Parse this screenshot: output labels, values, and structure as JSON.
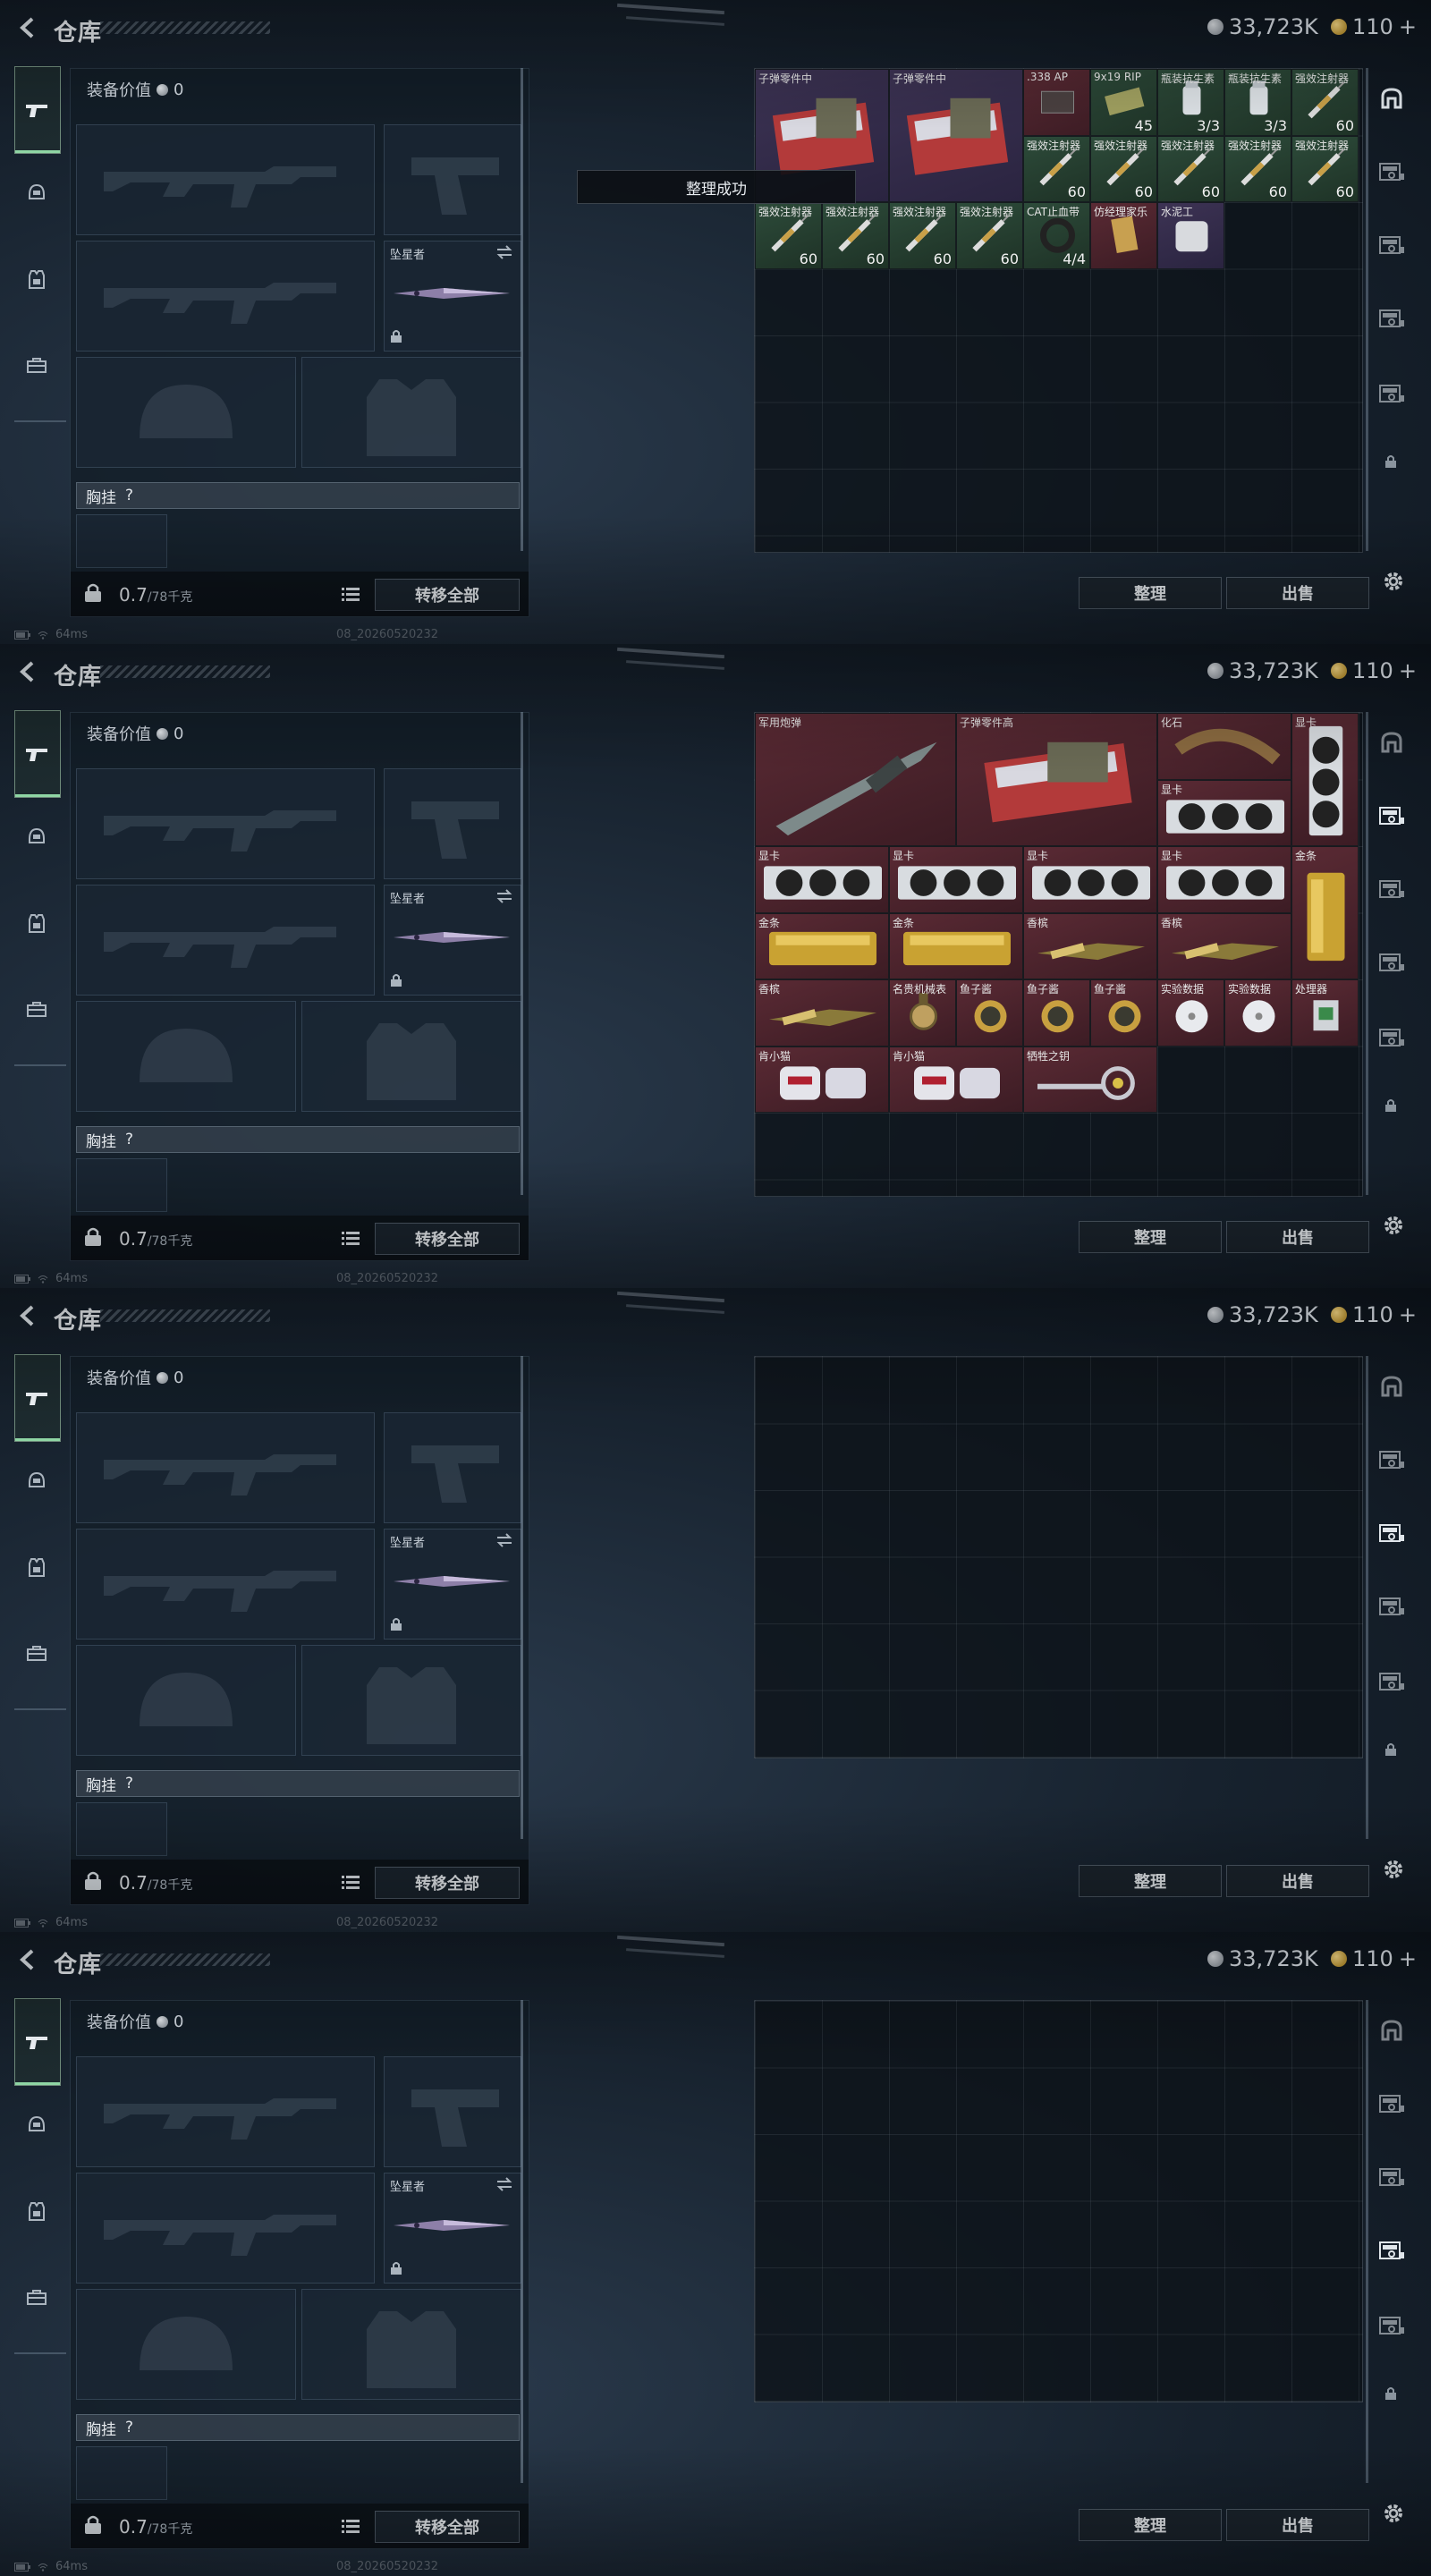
{
  "header": {
    "title": "仓库",
    "silver_amount": "33,723K",
    "gold_amount": "110",
    "gold_plus": "+"
  },
  "equipment": {
    "value_label": "装备价值",
    "value": "0",
    "knife_slot_label": "坠星者",
    "chest_label": "胸挂",
    "chest_help": "?",
    "weight_current": "0.7",
    "weight_max": "/78千克",
    "transfer_all": "转移全部"
  },
  "storage": {
    "organize_label": "整理",
    "sell_label": "出售",
    "toast": "整理成功"
  },
  "status": {
    "ping": "64ms",
    "uid": "08_20260520232"
  },
  "frames": [
    {
      "active_tab": 0,
      "show_toast": true,
      "items": [
        {
          "name": "子弹零件中",
          "col": 0,
          "row": 0,
          "w": 2,
          "h": 2,
          "bg": "purple",
          "vis": "ammo-parts"
        },
        {
          "name": "子弹零件中",
          "col": 2,
          "row": 0,
          "w": 2,
          "h": 2,
          "bg": "purple",
          "vis": "ammo-parts"
        },
        {
          "name": ".338 AP",
          "col": 4,
          "row": 0,
          "w": 1,
          "h": 1,
          "bg": "red",
          "vis": "ammo"
        },
        {
          "name": "9x19 RIP",
          "col": 5,
          "row": 0,
          "w": 1,
          "h": 1,
          "bg": "green",
          "vis": "ammo-box",
          "count": "45"
        },
        {
          "name": "瓶装抗生素",
          "col": 6,
          "row": 0,
          "w": 1,
          "h": 1,
          "bg": "green",
          "vis": "bottle",
          "count": "3/3"
        },
        {
          "name": "瓶装抗生素",
          "col": 7,
          "row": 0,
          "w": 1,
          "h": 1,
          "bg": "green",
          "vis": "bottle",
          "count": "3/3"
        },
        {
          "name": "强效注射器",
          "col": 8,
          "row": 0,
          "w": 1,
          "h": 1,
          "bg": "green",
          "vis": "syringe",
          "count": "60"
        },
        {
          "name": "强效注射器",
          "col": 4,
          "row": 1,
          "w": 1,
          "h": 1,
          "bg": "green",
          "vis": "syringe",
          "count": "60"
        },
        {
          "name": "强效注射器",
          "col": 5,
          "row": 1,
          "w": 1,
          "h": 1,
          "bg": "green",
          "vis": "syringe",
          "count": "60"
        },
        {
          "name": "强效注射器",
          "col": 6,
          "row": 1,
          "w": 1,
          "h": 1,
          "bg": "green",
          "vis": "syringe",
          "count": "60"
        },
        {
          "name": "强效注射器",
          "col": 7,
          "row": 1,
          "w": 1,
          "h": 1,
          "bg": "green",
          "vis": "syringe",
          "count": "60"
        },
        {
          "name": "强效注射器",
          "col": 8,
          "row": 1,
          "w": 1,
          "h": 1,
          "bg": "green",
          "vis": "syringe",
          "count": "60"
        },
        {
          "name": "强效注射器",
          "col": 0,
          "row": 2,
          "w": 1,
          "h": 1,
          "bg": "green",
          "vis": "syringe",
          "count": "60"
        },
        {
          "name": "强效注射器",
          "col": 1,
          "row": 2,
          "w": 1,
          "h": 1,
          "bg": "green",
          "vis": "syringe",
          "count": "60"
        },
        {
          "name": "强效注射器",
          "col": 2,
          "row": 2,
          "w": 1,
          "h": 1,
          "bg": "green",
          "vis": "syringe",
          "count": "60"
        },
        {
          "name": "强效注射器",
          "col": 3,
          "row": 2,
          "w": 1,
          "h": 1,
          "bg": "green",
          "vis": "syringe",
          "count": "60"
        },
        {
          "name": "CAT止血带",
          "col": 4,
          "row": 2,
          "w": 1,
          "h": 1,
          "bg": "green",
          "vis": "tourniquet",
          "count": "4/4"
        },
        {
          "name": "仿经理家乐",
          "col": 5,
          "row": 2,
          "w": 1,
          "h": 1,
          "bg": "red",
          "vis": "box"
        },
        {
          "name": "水泥工",
          "col": 6,
          "row": 2,
          "w": 1,
          "h": 1,
          "bg": "purple",
          "vis": "bag"
        }
      ]
    },
    {
      "active_tab": 1,
      "show_toast": false,
      "items": [
        {
          "name": "军用炮弹",
          "col": 0,
          "row": 0,
          "w": 3,
          "h": 2,
          "bg": "red",
          "vis": "shell"
        },
        {
          "name": "子弹零件高",
          "col": 3,
          "row": 0,
          "w": 3,
          "h": 2,
          "bg": "red",
          "vis": "ammo-parts"
        },
        {
          "name": "化石",
          "col": 6,
          "row": 0,
          "w": 2,
          "h": 1,
          "bg": "red",
          "vis": "fossil"
        },
        {
          "name": "显卡",
          "col": 8,
          "row": 0,
          "w": 1,
          "h": 2,
          "bg": "red",
          "vis": "gpu-v"
        },
        {
          "name": "显卡",
          "col": 6,
          "row": 1,
          "w": 2,
          "h": 1,
          "bg": "red",
          "vis": "gpu"
        },
        {
          "name": "显卡",
          "col": 0,
          "row": 2,
          "w": 2,
          "h": 1,
          "bg": "red",
          "vis": "gpu"
        },
        {
          "name": "显卡",
          "col": 2,
          "row": 2,
          "w": 2,
          "h": 1,
          "bg": "red",
          "vis": "gpu"
        },
        {
          "name": "显卡",
          "col": 4,
          "row": 2,
          "w": 2,
          "h": 1,
          "bg": "red",
          "vis": "gpu"
        },
        {
          "name": "显卡",
          "col": 6,
          "row": 2,
          "w": 2,
          "h": 1,
          "bg": "red",
          "vis": "gpu"
        },
        {
          "name": "金条",
          "col": 8,
          "row": 2,
          "w": 1,
          "h": 2,
          "bg": "red",
          "vis": "gold-v"
        },
        {
          "name": "金条",
          "col": 0,
          "row": 3,
          "w": 2,
          "h": 1,
          "bg": "red",
          "vis": "gold"
        },
        {
          "name": "金条",
          "col": 2,
          "row": 3,
          "w": 2,
          "h": 1,
          "bg": "red",
          "vis": "gold"
        },
        {
          "name": "香槟",
          "col": 4,
          "row": 3,
          "w": 2,
          "h": 1,
          "bg": "red",
          "vis": "champagne"
        },
        {
          "name": "香槟",
          "col": 6,
          "row": 3,
          "w": 2,
          "h": 1,
          "bg": "red",
          "vis": "champagne"
        },
        {
          "name": "香槟",
          "col": 0,
          "row": 4,
          "w": 2,
          "h": 1,
          "bg": "red",
          "vis": "champagne"
        },
        {
          "name": "名贵机械表",
          "col": 2,
          "row": 4,
          "w": 1,
          "h": 1,
          "bg": "red",
          "vis": "watch"
        },
        {
          "name": "鱼子酱",
          "col": 3,
          "row": 4,
          "w": 1,
          "h": 1,
          "bg": "red",
          "vis": "caviar"
        },
        {
          "name": "鱼子酱",
          "col": 4,
          "row": 4,
          "w": 1,
          "h": 1,
          "bg": "red",
          "vis": "caviar"
        },
        {
          "name": "鱼子酱",
          "col": 5,
          "row": 4,
          "w": 1,
          "h": 1,
          "bg": "red",
          "vis": "caviar"
        },
        {
          "name": "实验数据",
          "col": 6,
          "row": 4,
          "w": 1,
          "h": 1,
          "bg": "red",
          "vis": "disc"
        },
        {
          "name": "实验数据",
          "col": 7,
          "row": 4,
          "w": 1,
          "h": 1,
          "bg": "red",
          "vis": "disc"
        },
        {
          "name": "处理器",
          "col": 8,
          "row": 4,
          "w": 1,
          "h": 1,
          "bg": "red",
          "vis": "chip"
        },
        {
          "name": "肯小猫",
          "col": 0,
          "row": 5,
          "w": 2,
          "h": 1,
          "bg": "red",
          "vis": "toy"
        },
        {
          "name": "肯小猫",
          "col": 2,
          "row": 5,
          "w": 2,
          "h": 1,
          "bg": "red",
          "vis": "toy"
        },
        {
          "name": "牺牲之钥",
          "col": 4,
          "row": 5,
          "w": 2,
          "h": 1,
          "bg": "red",
          "vis": "key"
        }
      ]
    },
    {
      "active_tab": 2,
      "show_toast": false,
      "items": []
    },
    {
      "active_tab": 3,
      "show_toast": false,
      "items": []
    }
  ],
  "colors": {
    "rarity_green": "#2d4b3a",
    "rarity_red": "#5a2a34",
    "rarity_purple": "#3d3354",
    "accent_tab": "#8fd6a4"
  }
}
